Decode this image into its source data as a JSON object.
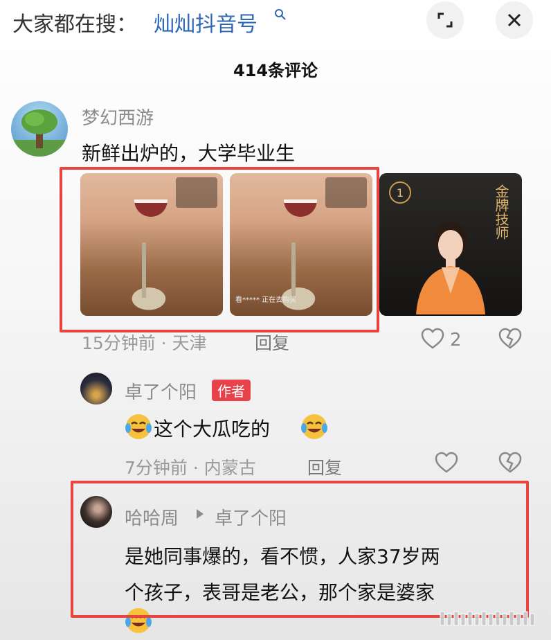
{
  "search": {
    "prefix": "大家都在搜：",
    "term": "灿灿抖音号"
  },
  "header": {
    "comment_count": "414条评论"
  },
  "comments": [
    {
      "username": "梦幻西游",
      "text": "新鲜出炉的，大学毕业生",
      "meta": "15分钟前 · 天津",
      "reply_label": "回复",
      "likes": "2",
      "images": [
        {
          "caption": ""
        },
        {
          "caption": "看***** 正在去购买"
        },
        {
          "title": "金牌技师",
          "badge": "1"
        }
      ]
    },
    {
      "username": "卓了个阳",
      "badge": "作者",
      "text": "这个大瓜吃的",
      "meta": "7分钟前 · 内蒙古",
      "reply_label": "回复"
    },
    {
      "username": "哈哈周",
      "reply_to": "卓了个阳",
      "text_line1": "是她同事爆的，看不惯，人家37岁两",
      "text_line2": "个孩子，表哥是老公，那个家是婆家"
    }
  ],
  "colors": {
    "accent_red": "#e9453f",
    "link_blue": "#2f67b6",
    "badge_red": "#e8434b"
  }
}
